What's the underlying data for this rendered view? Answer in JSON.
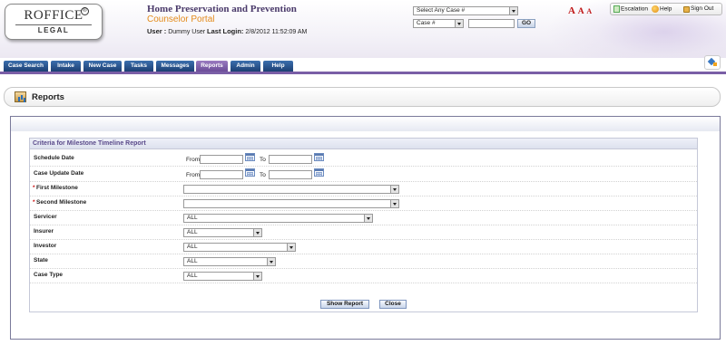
{
  "header": {
    "logo_main": "ROFFICE",
    "logo_reg": "®",
    "logo_sub": "LEGAL",
    "title": "Home Preservation and Prevention",
    "subtitle": "Counselor Portal",
    "user_label": "User :",
    "user_name": "Dummy User",
    "last_login_label": "Last Login:",
    "last_login_value": "2/8/2012 11:52:09 AM",
    "case_select": "Select Any Case #",
    "case_type_select": "Case #",
    "case_search_value": "",
    "go_label": "GO",
    "font_sizes": [
      "A",
      "A",
      "A"
    ],
    "links": {
      "escalation": "Escalation",
      "help": "Help",
      "sign_out": "Sign Out"
    }
  },
  "tabs": [
    {
      "label": "Case Search",
      "active": false
    },
    {
      "label": "Intake",
      "active": false
    },
    {
      "label": "New Case",
      "active": false
    },
    {
      "label": "Tasks",
      "active": false
    },
    {
      "label": "Messages",
      "active": false
    },
    {
      "label": "Reports",
      "active": true
    },
    {
      "label": "Admin",
      "active": false
    },
    {
      "label": "Help",
      "active": false
    }
  ],
  "page": {
    "title": "Reports",
    "criteria_title": "Criteria for Milestone Timeline Report",
    "from_label": "From",
    "to_label": "To",
    "required_mark": "*",
    "fields": {
      "schedule_date": {
        "label": "Schedule Date",
        "from": "",
        "to": ""
      },
      "case_update_date": {
        "label": "Case Update Date",
        "from": "",
        "to": ""
      },
      "first_milestone": {
        "label": "First Milestone",
        "value": ""
      },
      "second_milestone": {
        "label": "Second Milestone",
        "value": ""
      },
      "servicer": {
        "label": "Servicer",
        "value": "ALL"
      },
      "insurer": {
        "label": "Insurer",
        "value": "ALL"
      },
      "investor": {
        "label": "Investor",
        "value": "ALL"
      },
      "state": {
        "label": "State",
        "value": "ALL"
      },
      "case_type": {
        "label": "Case Type",
        "value": "ALL"
      }
    },
    "show_report_label": "Show Report",
    "close_label": "Close"
  },
  "colors": {
    "tab": "#1c3f73",
    "tab_active": "#6b4c98",
    "tab_line": "#7a5ea6",
    "title": "#4a3a6a",
    "subtitle": "#e38a1a",
    "required": "#cc1111"
  }
}
